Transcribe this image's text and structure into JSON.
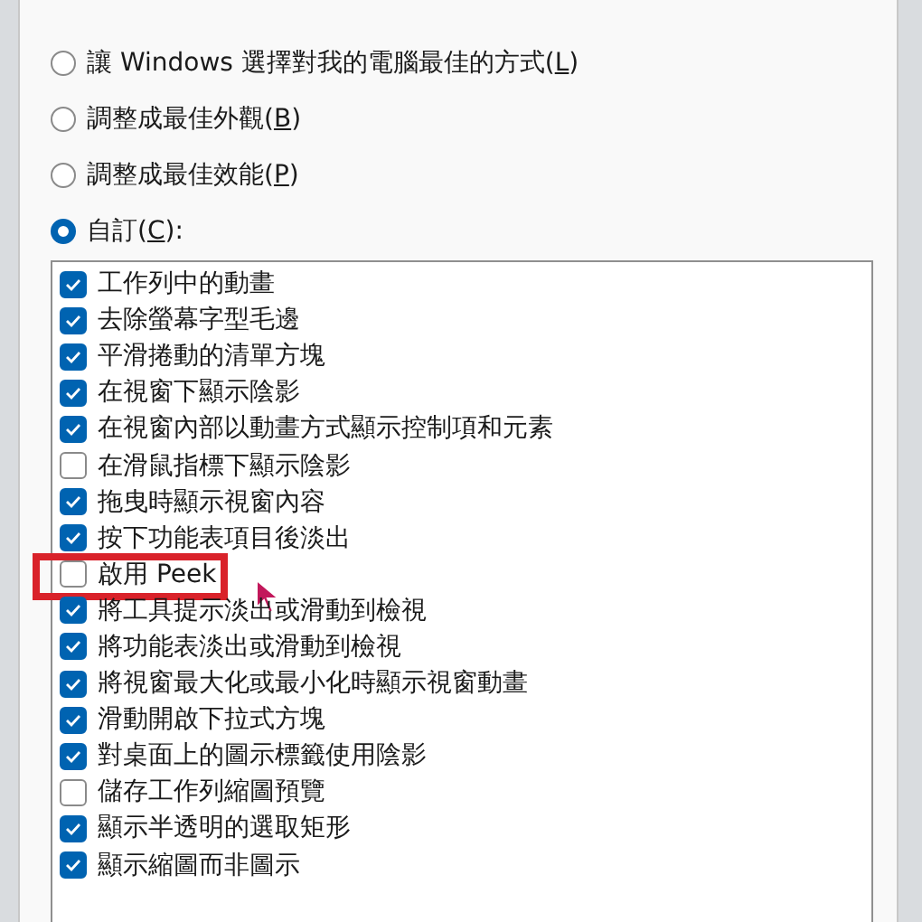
{
  "options": [
    {
      "text": "讓 Windows 選擇對我的電腦最佳的方式(",
      "access_key": "L",
      "text_after": ")",
      "selected": false
    },
    {
      "text": "調整成最佳外觀(",
      "access_key": "B",
      "text_after": ")",
      "selected": false
    },
    {
      "text": "調整成最佳效能(",
      "access_key": "P",
      "text_after": ")",
      "selected": false
    },
    {
      "text": "自訂(",
      "access_key": "C",
      "text_after": "):",
      "selected": true
    }
  ],
  "effects": [
    {
      "label": "工作列中的動畫",
      "checked": true,
      "highlighted": false
    },
    {
      "label": "去除螢幕字型毛邊",
      "checked": true,
      "highlighted": false
    },
    {
      "label": "平滑捲動的清單方塊",
      "checked": true,
      "highlighted": false
    },
    {
      "label": "在視窗下顯示陰影",
      "checked": true,
      "highlighted": false
    },
    {
      "label": "在視窗內部以動畫方式顯示控制項和元素",
      "checked": true,
      "highlighted": false
    },
    {
      "label": "在滑鼠指標下顯示陰影",
      "checked": false,
      "highlighted": false
    },
    {
      "label": "拖曳時顯示視窗內容",
      "checked": true,
      "highlighted": false
    },
    {
      "label": "按下功能表項目後淡出",
      "checked": true,
      "highlighted": false
    },
    {
      "label": "啟用 Peek",
      "checked": false,
      "highlighted": true
    },
    {
      "label": "將工具提示淡出或滑動到檢視",
      "checked": true,
      "highlighted": false
    },
    {
      "label": "將功能表淡出或滑動到檢視",
      "checked": true,
      "highlighted": false
    },
    {
      "label": "將視窗最大化或最小化時顯示視窗動畫",
      "checked": true,
      "highlighted": false
    },
    {
      "label": "滑動開啟下拉式方塊",
      "checked": true,
      "highlighted": false
    },
    {
      "label": "對桌面上的圖示標籤使用陰影",
      "checked": true,
      "highlighted": false
    },
    {
      "label": "儲存工作列縮圖預覽",
      "checked": false,
      "highlighted": false
    },
    {
      "label": "顯示半透明的選取矩形",
      "checked": true,
      "highlighted": false
    },
    {
      "label": "顯示縮圖而非圖示",
      "checked": true,
      "highlighted": false
    }
  ]
}
